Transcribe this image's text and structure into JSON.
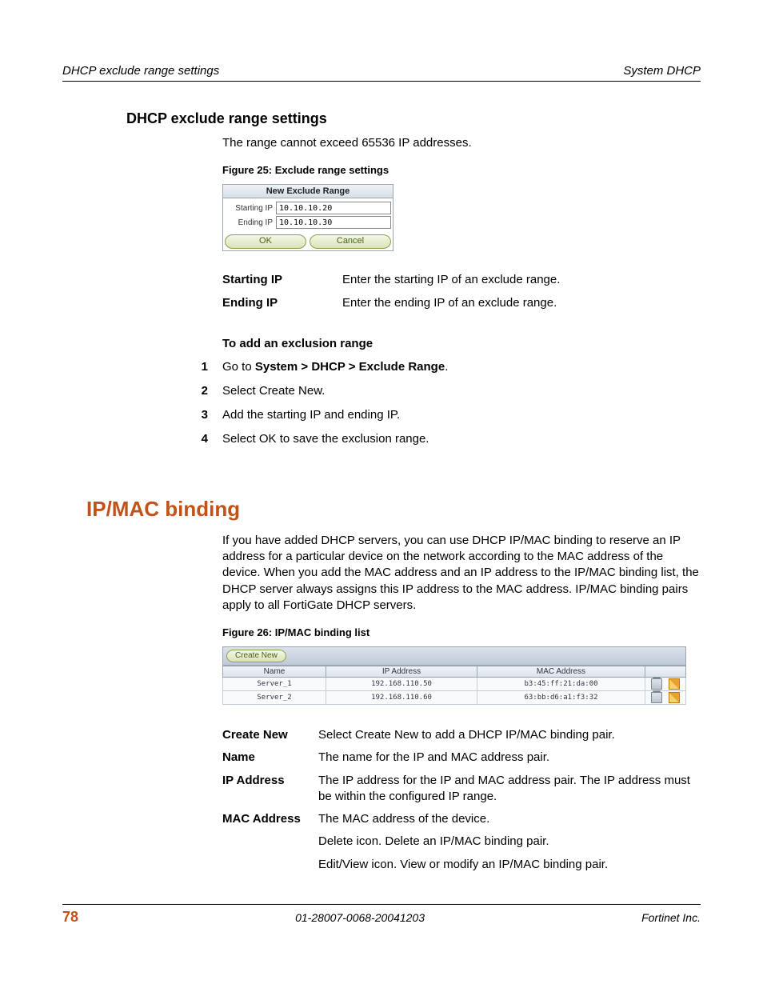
{
  "header": {
    "left": "DHCP exclude range settings",
    "right": "System DHCP"
  },
  "section1": {
    "title": "DHCP exclude range settings",
    "intro": "The range cannot exceed 65536 IP addresses.",
    "figcap": "Figure 25: Exclude range settings",
    "fig": {
      "title": "New Exclude Range",
      "start_label": "Starting IP",
      "start_value": "10.10.10.20",
      "end_label": "Ending IP",
      "end_value": "10.10.10.30",
      "ok": "OK",
      "cancel": "Cancel"
    },
    "fields": [
      {
        "k": "Starting IP",
        "v": "Enter the starting IP of an exclude range."
      },
      {
        "k": "Ending IP",
        "v": "Enter the ending IP of an exclude range."
      }
    ],
    "proc_title": "To add an exclusion range",
    "steps_prefix": "Go to ",
    "steps_path": "System > DHCP > Exclude Range",
    "steps": [
      "Go to System > DHCP > Exclude Range.",
      "Select Create New.",
      "Add the starting IP and ending IP.",
      "Select OK to save the exclusion range."
    ]
  },
  "section2": {
    "title": "IP/MAC binding",
    "intro": "If you have added DHCP servers, you can use DHCP IP/MAC binding to reserve an IP address for a particular device on the network according to the MAC address of the device. When you add the MAC address and an IP address to the IP/MAC binding list, the DHCP server always assigns this IP address to the MAC address. IP/MAC binding pairs apply to all FortiGate DHCP servers.",
    "figcap": "Figure 26: IP/MAC binding list",
    "fig": {
      "create_label": "Create New",
      "cols": [
        "Name",
        "IP Address",
        "MAC Address",
        ""
      ],
      "rows": [
        {
          "name": "Server_1",
          "ip": "192.168.110.50",
          "mac": "b3:45:ff:21:da:00"
        },
        {
          "name": "Server_2",
          "ip": "192.168.110.60",
          "mac": "63:bb:d6:a1:f3:32"
        }
      ]
    },
    "fields": [
      {
        "k": "Create New",
        "v": "Select Create New to add a DHCP IP/MAC binding pair."
      },
      {
        "k": "Name",
        "v": "The name for the IP and MAC address pair."
      },
      {
        "k": "IP Address",
        "v": "The IP address for the IP and MAC address pair. The IP address must be within the configured IP range."
      },
      {
        "k": "MAC Address",
        "v": "The MAC address of the device."
      },
      {
        "k": "",
        "v": "Delete icon. Delete an IP/MAC binding pair."
      },
      {
        "k": "",
        "v": "Edit/View icon. View or modify an IP/MAC binding pair."
      }
    ]
  },
  "footer": {
    "page": "78",
    "mid": "01-28007-0068-20041203",
    "right": "Fortinet Inc."
  }
}
